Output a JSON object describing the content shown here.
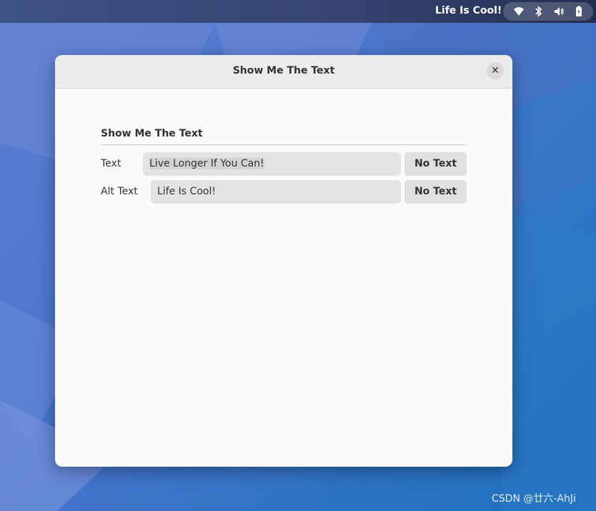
{
  "topbar": {
    "status_text": "Life Is Cool!",
    "tray_icons": [
      "wifi-icon",
      "bluetooth-icon",
      "volume-icon",
      "battery-icon"
    ]
  },
  "window": {
    "title": "Show Me The Text",
    "close_icon": "close-icon"
  },
  "section": {
    "title": "Show Me The Text"
  },
  "rows": [
    {
      "label": "Text",
      "value": "Live Longer If You Can!",
      "button_label": "No Text"
    },
    {
      "label": "Alt Text",
      "value": "Life Is Cool!",
      "button_label": "No Text"
    }
  ],
  "watermark": "CSDN @廿六-AhJi",
  "colors": {
    "window_bg": "#fafafa",
    "titlebar_bg": "#ebebeb",
    "entry_bg": "#e3e3e3",
    "button_bg": "#e0e0e0",
    "text": "#2e3436"
  }
}
